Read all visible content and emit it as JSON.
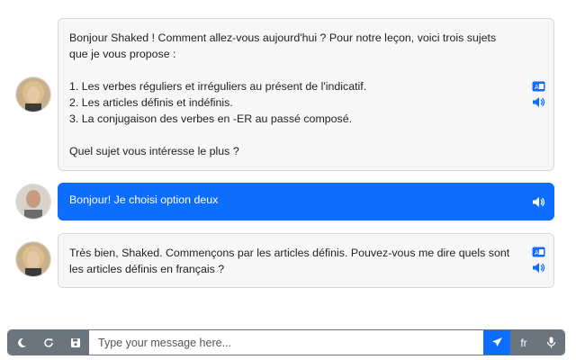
{
  "messages": [
    {
      "role": "assistant",
      "lines": [
        "Bonjour Shaked ! Comment allez-vous aujourd'hui ? Pour notre leçon, voici trois sujets que je vous propose :",
        "",
        "1. Les verbes réguliers et irréguliers au présent de l'indicatif.",
        "2. Les articles définis et indéfinis.",
        "3. La conjugaison des verbes en -ER au passé composé.",
        "",
        "Quel sujet vous intéresse le plus ?"
      ],
      "icons": [
        "translate-icon",
        "speaker-icon"
      ]
    },
    {
      "role": "user",
      "lines": [
        "Bonjour! Je choisi option deux"
      ],
      "icons": [
        "speaker-icon"
      ]
    },
    {
      "role": "assistant",
      "lines": [
        "Très bien, Shaked. Commençons par les articles définis. Pouvez-vous me dire quels sont les articles définis en français ?"
      ],
      "icons": [
        "translate-icon",
        "speaker-icon"
      ]
    }
  ],
  "input": {
    "placeholder": "Type your message here...",
    "language_label": "fr"
  },
  "toolbar": {
    "icons": [
      "moon-icon",
      "refresh-icon",
      "save-icon"
    ],
    "send_icon": "send-icon",
    "mic_icon": "microphone-icon"
  },
  "colors": {
    "primary": "#0d6efd",
    "secondary": "#6c757d",
    "assistant_bubble": "#f7f7f8"
  }
}
